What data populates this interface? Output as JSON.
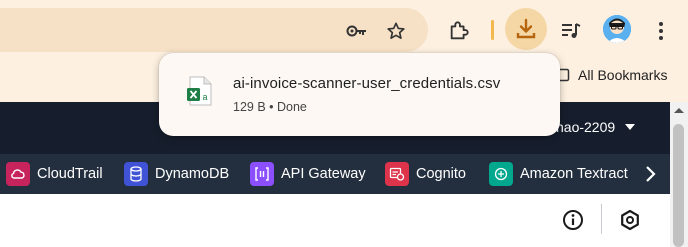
{
  "download": {
    "filename": "ai-invoice-scanner-user_credentials.csv",
    "status": "129 B • Done"
  },
  "bookmarks": {
    "all_label": "All Bookmarks"
  },
  "aws": {
    "account_label": "hao-2209",
    "favorites": [
      {
        "label": "CloudTrail",
        "icon": "cloudtrail-icon",
        "color": "#c7235d"
      },
      {
        "label": "DynamoDB",
        "icon": "dynamodb-icon",
        "color": "#4053d6"
      },
      {
        "label": "API Gateway",
        "icon": "api-gateway-icon",
        "color": "#8c4fff"
      },
      {
        "label": "Cognito",
        "icon": "cognito-icon",
        "color": "#dd344c"
      },
      {
        "label": "Amazon Textract",
        "icon": "textract-icon",
        "color": "#01a88d"
      }
    ]
  },
  "colors": {
    "toolbar_bg": "#fdf0e0",
    "aws_header": "#161e2d",
    "aws_favorites_bar": "#232f3e",
    "download_accent": "#b5650d"
  }
}
